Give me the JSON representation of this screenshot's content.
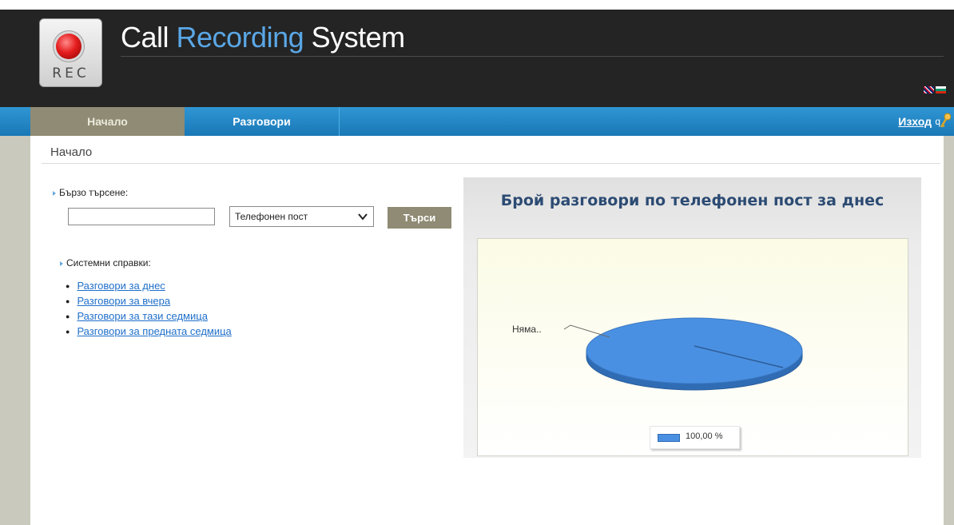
{
  "header": {
    "title_part1": "Call",
    "title_part2": "Recording",
    "title_part3": "System",
    "logo_text": "REC"
  },
  "nav": {
    "tabs": [
      {
        "label": "Начало",
        "active": true
      },
      {
        "label": "Разговори",
        "active": false
      }
    ],
    "logout_label": "Изход",
    "user_initial": "q"
  },
  "breadcrumb": "Начало",
  "quick_search": {
    "label": "Бързо търсене:",
    "input_value": "",
    "select_value": "Телефонен пост",
    "button_label": "Търси"
  },
  "system_reports": {
    "label": "Системни справки:",
    "items": [
      "Разговори за днес",
      "Разговори за вчера",
      "Разговори за тази седмица",
      "Разговори за предната седмица"
    ]
  },
  "colors": {
    "header_bg": "#242424",
    "nav_bg": "#1a78b6",
    "accent": "#5aa7e6",
    "active_tab": "#8f8b74",
    "pie": "#4a90e2"
  },
  "chart_data": {
    "type": "pie",
    "title": "Брой разговори по телефонен пост за днес",
    "categories": [
      "Няма.."
    ],
    "values": [
      100
    ],
    "slice_label": "Няма..",
    "legend_entries": [
      "100,00 %"
    ],
    "legend_placement": "bottom"
  }
}
